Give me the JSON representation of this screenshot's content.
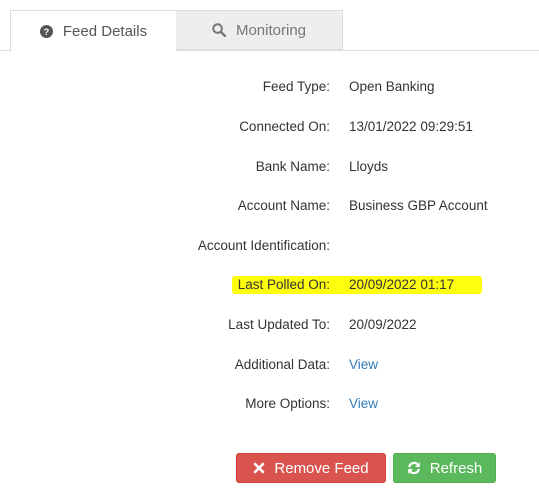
{
  "tabs": {
    "feed_details": {
      "label": "Feed Details",
      "icon": "question-circle-icon"
    },
    "monitoring": {
      "label": "Monitoring",
      "icon": "search-icon"
    }
  },
  "details": {
    "feed_type": {
      "label": "Feed Type:",
      "value": "Open Banking"
    },
    "connected_on": {
      "label": "Connected On:",
      "value": "13/01/2022 09:29:51"
    },
    "bank_name": {
      "label": "Bank Name:",
      "value": "Lloyds"
    },
    "account_name": {
      "label": "Account Name:",
      "value": "Business GBP Account"
    },
    "account_identification": {
      "label": "Account Identification:",
      "value": ""
    },
    "last_polled_on": {
      "label": "Last Polled On:",
      "value": "20/09/2022 01:17"
    },
    "last_updated_to": {
      "label": "Last Updated To:",
      "value": "20/09/2022"
    },
    "additional_data": {
      "label": "Additional Data:",
      "link": "View"
    },
    "more_options": {
      "label": "More Options:",
      "link": "View"
    }
  },
  "buttons": {
    "remove_feed": {
      "label": "Remove Feed",
      "icon": "times-icon"
    },
    "refresh": {
      "label": "Refresh",
      "icon": "refresh-icon"
    }
  },
  "colors": {
    "link": "#337ab7",
    "danger": "#d9534f",
    "success": "#5cb85c",
    "highlight": "#ffff00"
  }
}
